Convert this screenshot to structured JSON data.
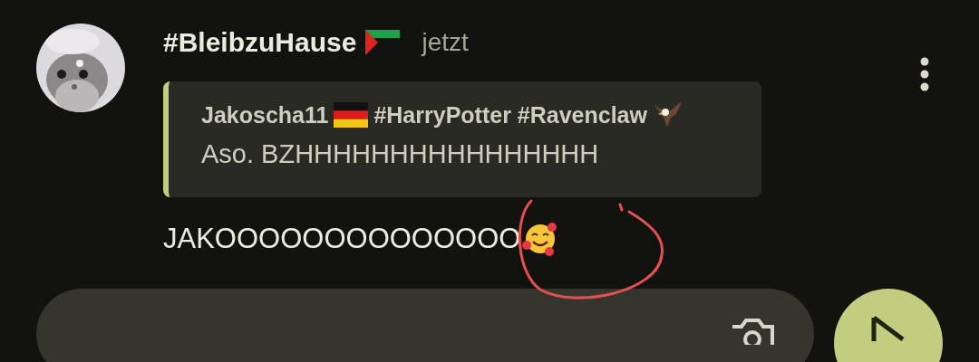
{
  "post": {
    "author": "#BleibzuHause",
    "time": "jetzt",
    "quote": {
      "author": "Jakoscha11",
      "tags": "#HarryPotter #Ravenclaw",
      "text": "Aso. BZHHHHHHHHHHHHHHHH"
    },
    "text": "JAKOOOOOOOOOOOOOO"
  }
}
